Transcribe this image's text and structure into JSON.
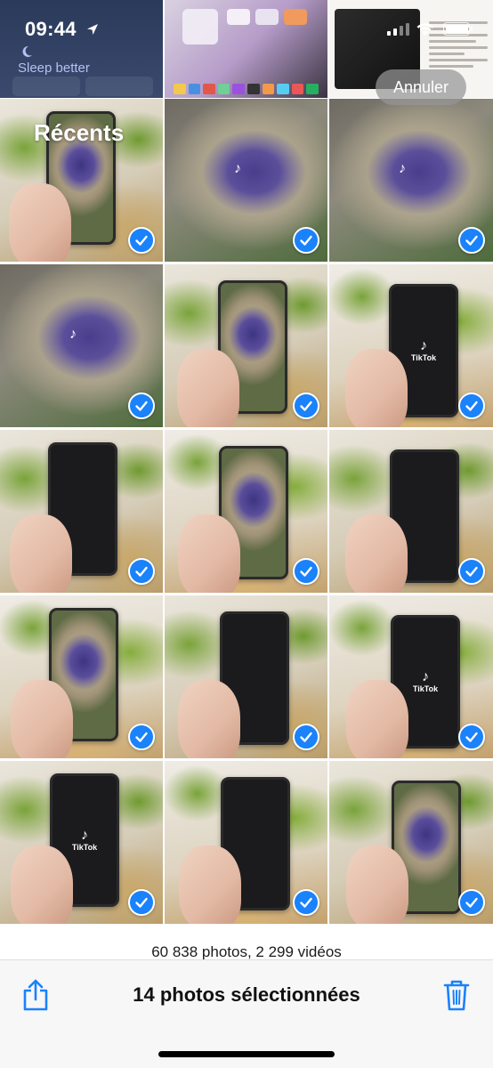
{
  "status_bar": {
    "time": "09:44"
  },
  "header": {
    "title": "Récents",
    "cancel_label": "Annuler"
  },
  "top_thumbnails": {
    "sleep_widget_title": "Sleep better"
  },
  "grid": {
    "items": [
      {
        "label": "photo-1",
        "scene": "hand-crater",
        "selected": true
      },
      {
        "label": "photo-2",
        "scene": "crater-closeup",
        "selected": true
      },
      {
        "label": "photo-3",
        "scene": "crater-closeup",
        "selected": true
      },
      {
        "label": "photo-4",
        "scene": "crater-closeup",
        "selected": true
      },
      {
        "label": "photo-5",
        "scene": "hand-crater",
        "selected": true
      },
      {
        "label": "photo-6",
        "scene": "hand-tiktok",
        "selected": true
      },
      {
        "label": "photo-7",
        "scene": "hand-dark",
        "selected": true
      },
      {
        "label": "photo-8",
        "scene": "hand-crater",
        "selected": true
      },
      {
        "label": "photo-9",
        "scene": "hand-dark",
        "selected": true
      },
      {
        "label": "photo-10",
        "scene": "hand-crater",
        "selected": true
      },
      {
        "label": "photo-11",
        "scene": "hand-dark",
        "selected": true
      },
      {
        "label": "photo-12",
        "scene": "hand-tiktok",
        "selected": true
      },
      {
        "label": "photo-13",
        "scene": "hand-tiktok",
        "selected": true
      },
      {
        "label": "photo-14",
        "scene": "hand-dark",
        "selected": true
      },
      {
        "label": "photo-15",
        "scene": "hand-crater",
        "selected": true
      }
    ],
    "tiktok_text": "TikTok"
  },
  "library": {
    "count_text": "60 838 photos, 2 299 vidéos"
  },
  "toolbar": {
    "selection_label": "14 photos sélectionnées",
    "share_icon": "share-icon",
    "delete_icon": "trash-icon"
  },
  "colors": {
    "accent": "#1a82fb",
    "toolbar_bg": "#f7f7f7"
  }
}
